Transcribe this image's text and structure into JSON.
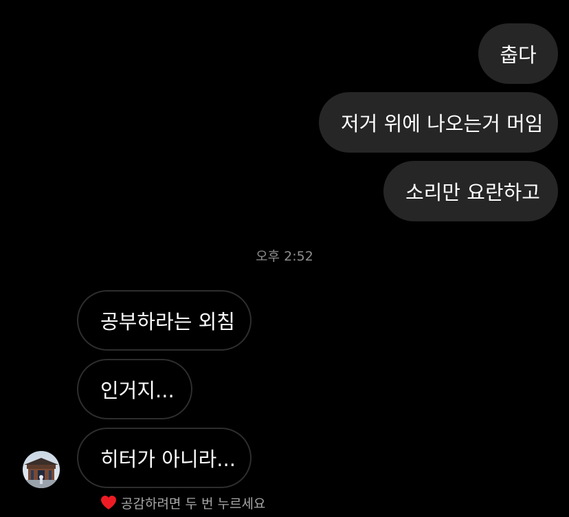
{
  "messages": {
    "sent": [
      {
        "text": "춥다"
      },
      {
        "text": "저거 위에 나오는거 머임"
      },
      {
        "text": "소리만 요란하고"
      }
    ],
    "timestamp": "오후 2:52",
    "received": [
      {
        "text": "공부하라는 외침"
      },
      {
        "text": "인거지..."
      },
      {
        "text": "히터가 아니라..."
      }
    ]
  },
  "reaction_hint": {
    "icon": "heart-icon",
    "text": "공감하려면 두 번 누르세요"
  },
  "colors": {
    "background": "#000000",
    "sent_bubble": "#262626",
    "received_border": "#2e2e2e",
    "timestamp": "#8e8e8e",
    "heart": "#ed1c24"
  }
}
